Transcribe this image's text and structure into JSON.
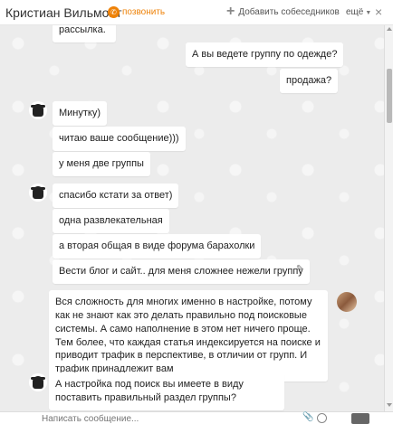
{
  "header": {
    "contact_name": "Кристиан Вильмонт",
    "call_label": "позвонить",
    "add_label": "Добавить собеседников",
    "more_label": "ещё",
    "close_glyph": "×",
    "call_glyph": "✆",
    "plus_glyph": "+",
    "caret_glyph": "▼"
  },
  "messages": [
    {
      "text": "рассылка."
    },
    {
      "text": "А вы ведете группу по одежде?"
    },
    {
      "text": "продажа?"
    },
    {
      "text": "Минутку)"
    },
    {
      "text": "читаю ваше сообщение)))"
    },
    {
      "text": "у меня две группы"
    },
    {
      "text": "спасибо кстати за ответ)"
    },
    {
      "text": "одна развлекательная"
    },
    {
      "text": "а вторая общая в виде форума барахолки"
    },
    {
      "text": "Вести блог и сайт.. для меня сложнее нежели группу"
    },
    {
      "text": "Вся сложность для многих именно в настройке, потому как не знают как это делать правильно под поисковые системы. А само наполнение в этом нет ничего проще. Тем более, что каждая статья индексируется на поиске и приводит трафик в перспективе, в отличии от групп. И трафик принадлежит вам"
    },
    {
      "text": "А настройка под поиск вы имеете в виду поставить правильный раздел группы?"
    }
  ],
  "composer": {
    "placeholder": "Написать сообщение..."
  },
  "icons": {
    "edit": "✎",
    "clip": "📎"
  }
}
